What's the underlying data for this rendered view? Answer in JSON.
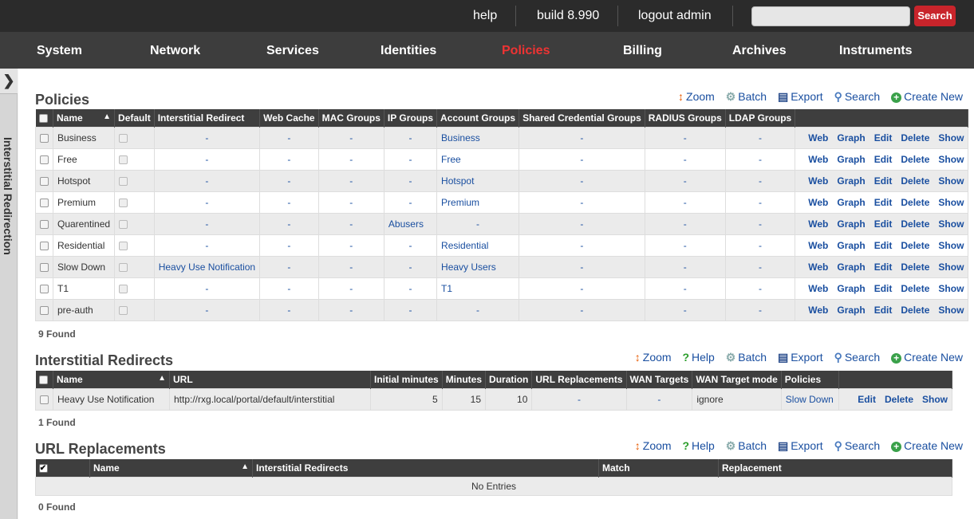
{
  "topbar": {
    "help": "help",
    "build": "build 8.990",
    "logout": "logout admin",
    "search_placeholder": "",
    "search_button": "Search"
  },
  "nav": [
    "System",
    "Network",
    "Services",
    "Identities",
    "Policies",
    "Billing",
    "Archives",
    "Instruments"
  ],
  "nav_active": "Policies",
  "sidebar": {
    "label": "Interstitial Redirection"
  },
  "actions": {
    "zoom": "Zoom",
    "help": "Help",
    "batch": "Batch",
    "export": "Export",
    "search": "Search",
    "create_new": "Create New"
  },
  "policies": {
    "title": "Policies",
    "columns": [
      "Name",
      "Default",
      "Interstitial Redirect",
      "Web Cache",
      "MAC Groups",
      "IP Groups",
      "Account Groups",
      "Shared Credential Groups",
      "RADIUS Groups",
      "LDAP Groups"
    ],
    "ops": [
      "Web",
      "Graph",
      "Edit",
      "Delete",
      "Show"
    ],
    "rows": [
      [
        "Business",
        "-",
        "-",
        "-",
        "-",
        "Business",
        "-",
        "-",
        "-"
      ],
      [
        "Free",
        "-",
        "-",
        "-",
        "-",
        "Free",
        "-",
        "-",
        "-"
      ],
      [
        "Hotspot",
        "-",
        "-",
        "-",
        "-",
        "Hotspot",
        "-",
        "-",
        "-"
      ],
      [
        "Premium",
        "-",
        "-",
        "-",
        "-",
        "Premium",
        "-",
        "-",
        "-"
      ],
      [
        "Quarentined",
        "-",
        "-",
        "-",
        "Abusers",
        "-",
        "-",
        "-",
        "-"
      ],
      [
        "Residential",
        "-",
        "-",
        "-",
        "-",
        "Residential",
        "-",
        "-",
        "-"
      ],
      [
        "Slow Down",
        "Heavy Use Notification",
        "-",
        "-",
        "-",
        "Heavy Users",
        "-",
        "-",
        "-"
      ],
      [
        "T1",
        "-",
        "-",
        "-",
        "-",
        "T1",
        "-",
        "-",
        "-"
      ],
      [
        "pre-auth",
        "-",
        "-",
        "-",
        "-",
        "-",
        "-",
        "-",
        "-"
      ]
    ],
    "found": "9 Found"
  },
  "interstitial": {
    "title": "Interstitial Redirects",
    "columns": [
      "Name",
      "URL",
      "Initial minutes",
      "Minutes",
      "Duration",
      "URL Replacements",
      "WAN Targets",
      "WAN Target mode",
      "Policies"
    ],
    "ops": [
      "Edit",
      "Delete",
      "Show"
    ],
    "rows": [
      [
        "Heavy Use Notification",
        "http://rxg.local/portal/default/interstitial",
        "5",
        "15",
        "10",
        "-",
        "-",
        "ignore",
        "Slow Down"
      ]
    ],
    "found": "1 Found"
  },
  "url_replacements": {
    "title": "URL Replacements",
    "columns": [
      "Name",
      "Interstitial Redirects",
      "Match",
      "Replacement"
    ],
    "empty": "No Entries",
    "found": "0 Found"
  }
}
